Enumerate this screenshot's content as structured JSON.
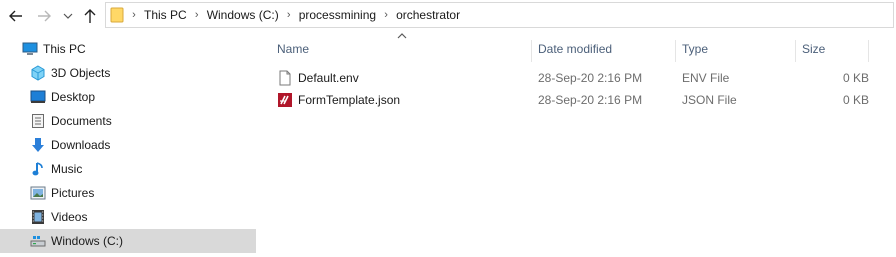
{
  "window": {
    "address_path": [
      "This PC",
      "Windows (C:)",
      "processmining",
      "orchestrator"
    ]
  },
  "nav": {
    "items": [
      {
        "label": "This PC",
        "icon": "pc-icon"
      },
      {
        "label": "3D Objects",
        "icon": "3d-objects-icon"
      },
      {
        "label": "Desktop",
        "icon": "desktop-icon"
      },
      {
        "label": "Documents",
        "icon": "documents-icon"
      },
      {
        "label": "Downloads",
        "icon": "downloads-icon"
      },
      {
        "label": "Music",
        "icon": "music-icon"
      },
      {
        "label": "Pictures",
        "icon": "pictures-icon"
      },
      {
        "label": "Videos",
        "icon": "videos-icon"
      },
      {
        "label": "Windows (C:)",
        "icon": "drive-icon",
        "selected": true
      }
    ]
  },
  "columns": {
    "name": "Name",
    "date": "Date modified",
    "type": "Type",
    "size": "Size",
    "sort": "name-ascending"
  },
  "files": [
    {
      "name": "Default.env",
      "date": "28-Sep-20 2:16 PM",
      "type": "ENV File",
      "size": "0 KB",
      "icon": "generic-file-icon"
    },
    {
      "name": "FormTemplate.json",
      "date": "28-Sep-20 2:16 PM",
      "type": "JSON File",
      "size": "0 KB",
      "icon": "json-file-icon"
    }
  ],
  "colors": {
    "selection": "#d9d9d9",
    "header_text": "#4c607a",
    "meta_text": "#6d6d6d",
    "accent_blue": "#0078d7",
    "folder_yellow": "#ffd867"
  }
}
